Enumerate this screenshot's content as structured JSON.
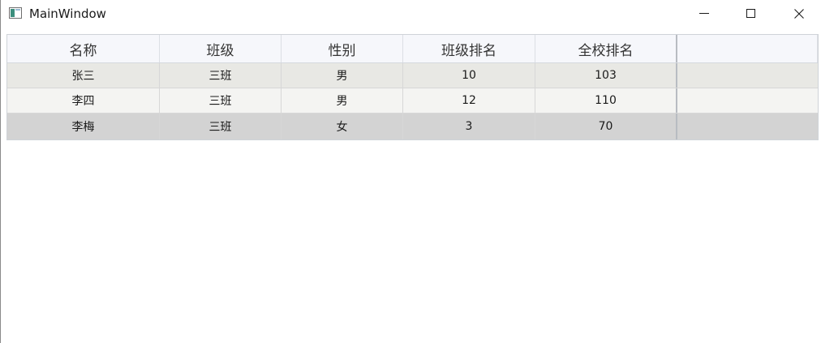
{
  "window": {
    "title": "MainWindow"
  },
  "grid": {
    "columns": [
      "名称",
      "班级",
      "性别",
      "班级排名",
      "全校排名"
    ],
    "rows": [
      [
        "张三",
        "三班",
        "男",
        "10",
        "103"
      ],
      [
        "李四",
        "三班",
        "男",
        "12",
        "110"
      ],
      [
        "李梅",
        "三班",
        "女",
        "3",
        "70"
      ]
    ],
    "selected_row": 2
  },
  "colors": {
    "header_bg": "#f6f7fb",
    "row_alt_bg": "#e8e8e4",
    "row_bg": "#f4f4f2",
    "selected_row_bg": "#d3d3d3"
  },
  "icons": {
    "app": "window-app-icon",
    "minimize": "minimize-icon",
    "maximize": "maximize-icon",
    "close": "close-icon"
  }
}
